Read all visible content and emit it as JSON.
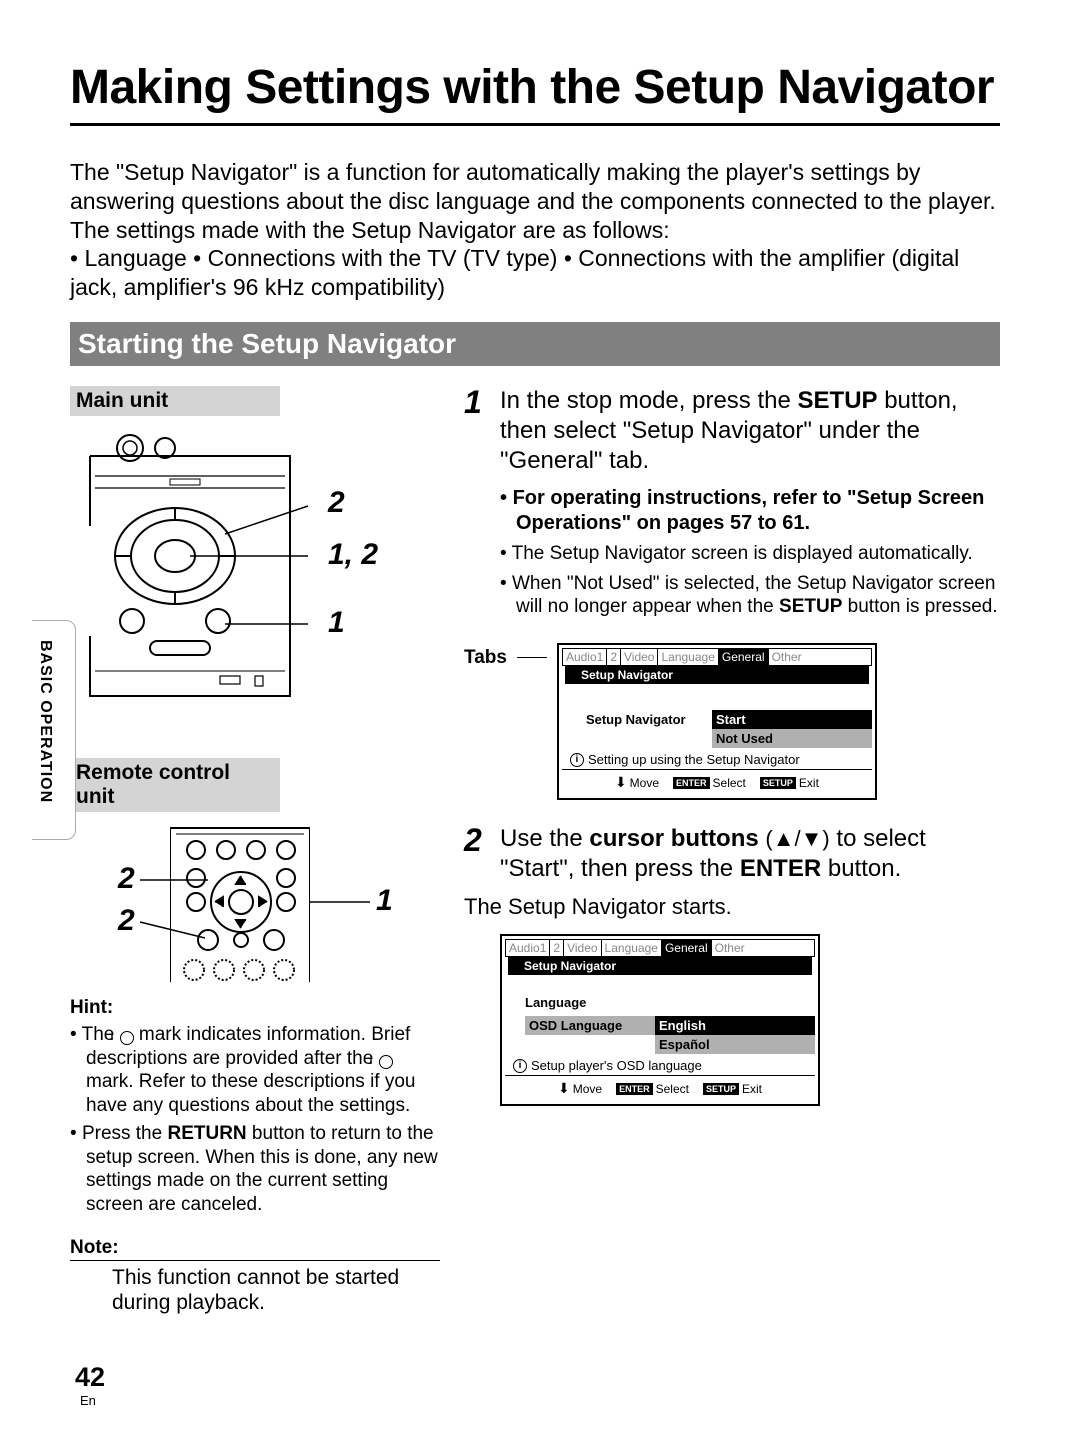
{
  "title": "Making Settings with the Setup Navigator",
  "intro": {
    "p1": "The \"Setup Navigator\" is a function for automatically making the player's settings by answering questions about the disc language and the components connected to the player.",
    "p2": "The settings made with the Setup Navigator are as follows:",
    "p3": "• Language • Connections with the TV (TV type) • Connections with the amplifier (digital jack, amplifier's 96 kHz compatibility)"
  },
  "section_heading": "Starting the Setup Navigator",
  "sidebar_tab": "BASIC OPERATION",
  "left": {
    "main_unit": "Main unit",
    "remote_unit": "Remote control unit",
    "main_nums": {
      "a": "2",
      "b": "1, 2",
      "c": "1"
    },
    "remote_nums": {
      "left_top": "2",
      "left_bot": "2",
      "right": "1"
    },
    "hint_title": "Hint:",
    "hint1_a": "The ",
    "hint1_b": " mark indicates information.  Brief descriptions are provided after the ",
    "hint1_c": " mark.  Refer to these descriptions if you have any questions about the settings.",
    "hint2_a": "Press the ",
    "hint2_return": "RETURN",
    "hint2_b": " button to return to the setup screen.  When this is done, any new settings made on the current setting screen are canceled.",
    "note_title": "Note:",
    "note_text": "This function cannot be started during playback."
  },
  "steps": {
    "s1": {
      "num": "1",
      "a": "In the stop mode, press the ",
      "setup": "SETUP",
      "b": " button, then select \"Setup Navigator\" under the \"General\" tab.",
      "sub1": "For operating instructions, refer to \"Setup Screen Operations\" on pages 57 to 61.",
      "sub2": "The Setup Navigator screen is displayed automatically.",
      "sub3_a": "When \"Not Used\" is selected, the Setup Navigator screen will no longer appear when the ",
      "sub3_b": " button is pressed."
    },
    "tabs_label": "Tabs",
    "s2": {
      "num": "2",
      "a": "Use the ",
      "cursor": "cursor buttons",
      "glyphs": "(▲/▼)",
      "b": " to select \"Start\", then press the ",
      "enter": "ENTER",
      "c": " button.",
      "result": "The Setup Navigator starts."
    }
  },
  "osd1": {
    "tabs": [
      "Audio1",
      "2",
      "Video",
      "Language",
      "General",
      "Other"
    ],
    "header": "Setup Navigator",
    "menu_item": "Setup Navigator",
    "opt_start": "Start",
    "opt_notused": "Not Used",
    "info": "Setting up using the Setup Navigator",
    "foot_move": "Move",
    "foot_select": "Select",
    "foot_exit": "Exit",
    "enter_badge": "ENTER",
    "setup_badge": "SETUP"
  },
  "osd2": {
    "tabs": [
      "Audio1",
      "2",
      "Video",
      "Language",
      "General",
      "Other"
    ],
    "header": "Setup Navigator",
    "section": "Language",
    "row_label": "OSD Language",
    "opt_en": "English",
    "opt_es": "Español",
    "info": "Setup player's OSD language",
    "foot_move": "Move",
    "foot_select": "Select",
    "foot_exit": "Exit",
    "enter_badge": "ENTER",
    "setup_badge": "SETUP"
  },
  "page": {
    "num": "42",
    "lang": "En"
  }
}
